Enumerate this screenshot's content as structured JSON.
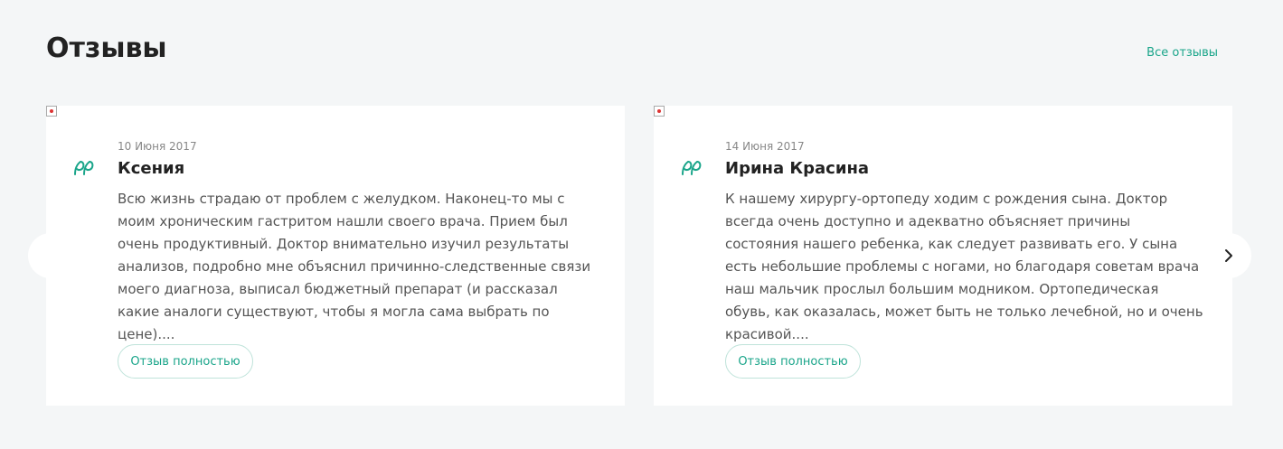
{
  "section": {
    "title": "Отзывы",
    "all_link": "Все отзывы"
  },
  "reviews": [
    {
      "date": "10 Июня 2017",
      "name": "Ксения",
      "text": "Всю жизнь страдаю от проблем с желудком. Наконец-то мы с моим хроническим гастритом нашли своего врача. Прием был очень продуктивный. Доктор внимательно изучил результаты анализов, подробно мне объяснил причинно-следственные связи моего диагноза, выписал бюджетный препарат (и рассказал какие аналоги существуют, чтобы я могла сама выбрать по цене)....",
      "button": "Отзыв полностью"
    },
    {
      "date": "14 Июня 2017",
      "name": "Ирина Красина",
      "text": "К нашему хирургу-ортопеду ходим с рождения сына. Доктор всегда очень доступно и адекватно объясняет причины состояния нашего ребенка, как следует развивать его. У сына есть небольшие проблемы с ногами, но благодаря советам врача наш мальчик прослыл большим модником. Ортопедическая обувь, как оказалась, может быть не только лечебной, но и очень красивой....",
      "button": "Отзыв полностью"
    }
  ],
  "colors": {
    "accent": "#1aa58a",
    "background": "#f4f6f7",
    "card": "#ffffff"
  },
  "icons": {
    "quote": "quote-icon",
    "prev": "chevron-left-icon",
    "next": "chevron-right-icon"
  }
}
